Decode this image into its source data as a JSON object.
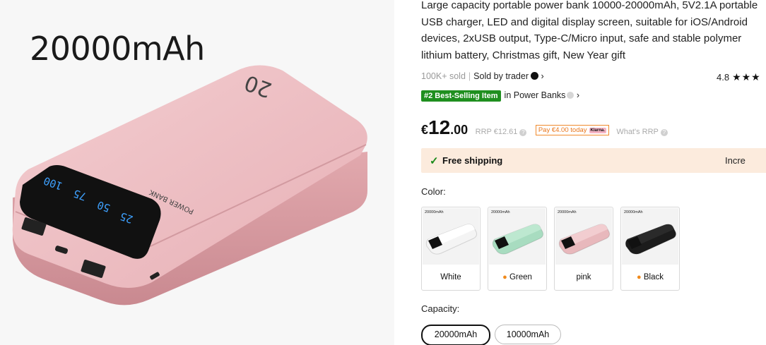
{
  "hero": {
    "caption": "20000mAh",
    "device_label": "POWER BANK",
    "device_capacity": "20",
    "display_numbers": [
      "100",
      "75",
      "50",
      "25"
    ]
  },
  "product": {
    "title": "Large capacity portable power bank 10000-20000mAh, 5V2.1A portable USB charger, LED and digital display screen, suitable for iOS/Android devices, 2xUSB output, Type-C/Micro input, safe and stable polymer lithium battery, Christmas gift, New Year gift",
    "sold": "100K+ sold",
    "sold_by": "Sold by trader",
    "rating": "4.8",
    "stars": "★★★",
    "badge": "#2 Best-Selling Item",
    "badge_in": "in Power Banks",
    "price_currency": "€",
    "price_int": "12",
    "price_dec": ".00",
    "rrp": "RRP €12.61",
    "pay_today": "Pay €4.00 today",
    "klarna": "Klarna.",
    "whats_rrp": "What's RRP",
    "shipping": "Free shipping",
    "shipping_more": "Incre"
  },
  "color": {
    "label": "Color:",
    "options": [
      {
        "label": "White",
        "flame": false,
        "body": "#f4f4f4",
        "top": "#ffffff"
      },
      {
        "label": "Green",
        "flame": true,
        "body": "#a8dcc0",
        "top": "#bde8d0"
      },
      {
        "label": "pink",
        "flame": false,
        "body": "#e8b8bc",
        "top": "#f2cdd0"
      },
      {
        "label": "Black",
        "flame": true,
        "body": "#1c1c1c",
        "top": "#2a2a2a"
      }
    ],
    "thumb_caption": "20000mAh"
  },
  "capacity": {
    "label": "Capacity:",
    "options": [
      "20000mAh",
      "10000mAh"
    ],
    "selected": "20000mAh"
  }
}
